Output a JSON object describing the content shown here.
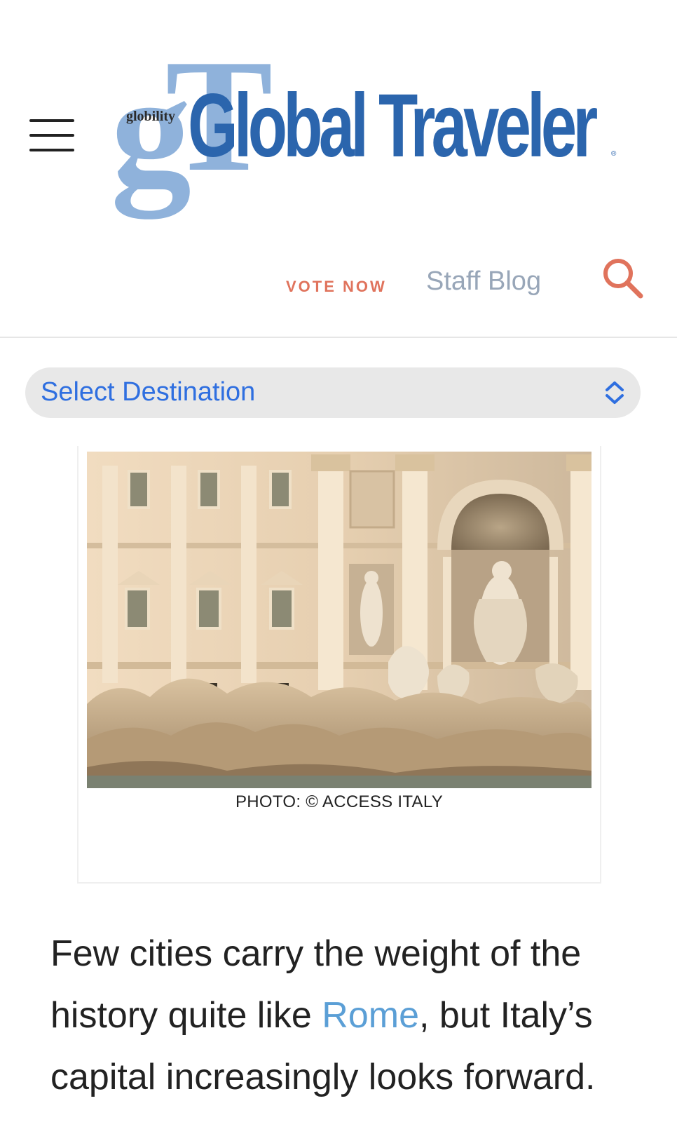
{
  "header": {
    "menu_icon": "hamburger-menu-icon",
    "logo": {
      "small_text": "globility",
      "main_text": "Global Traveler",
      "registered_mark": "®"
    },
    "nav": {
      "vote_now": "VOTE NOW",
      "staff_blog": "Staff Blog"
    },
    "search_icon": "search-icon",
    "accent_color": "#e0735c",
    "brand_color": "#2b65ad"
  },
  "destination_select": {
    "label": "Select Destination",
    "icon": "chevron-up-down-icon",
    "color": "#2f6fe0"
  },
  "figure": {
    "image_alt": "Trevi Fountain, Rome",
    "caption": "PHOTO: © ACCESS ITALY"
  },
  "article": {
    "text_before": "Few cities carry the weight of the history quite like ",
    "link_text": "Rome",
    "text_after": ", but Italy’s capital increasingly looks forward.",
    "link_color": "#5b9fd6"
  }
}
